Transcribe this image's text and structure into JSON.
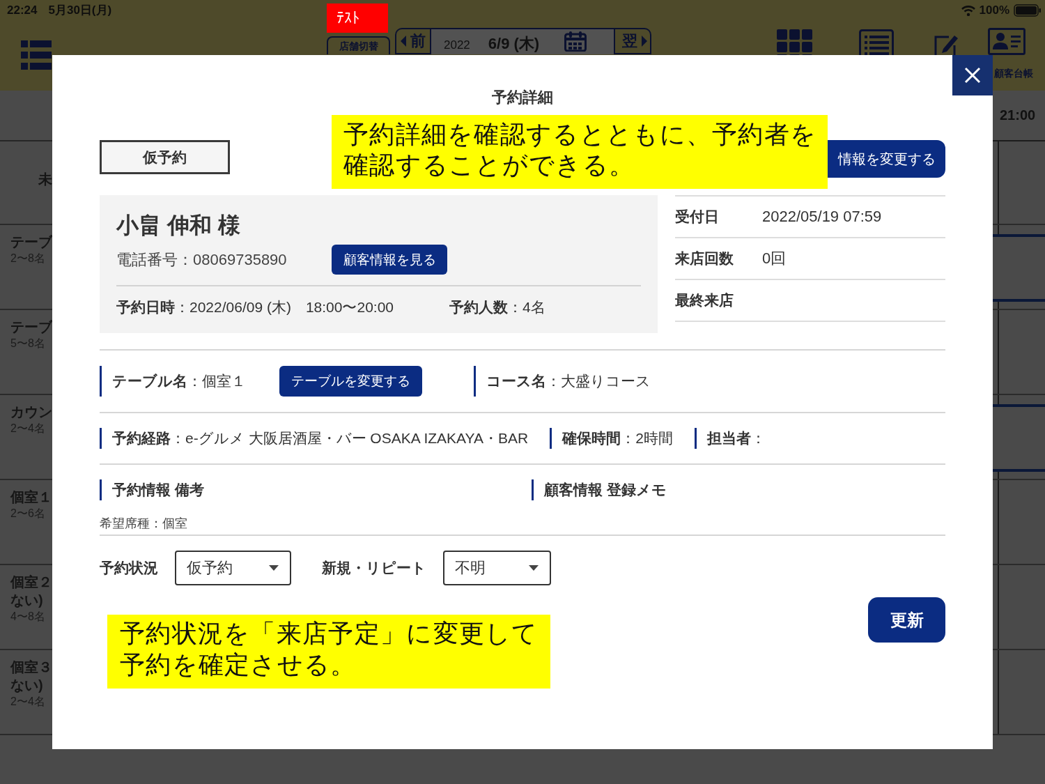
{
  "status_bar": {
    "time": "22:24",
    "date": "5月30日(月)",
    "battery": "100%"
  },
  "header": {
    "badge": "ﾃｽﾄ",
    "store_switch": "店舗切替",
    "date_nav": {
      "prev": "前",
      "year": "2022",
      "date": "6/9 (木)",
      "next": "翌"
    },
    "customer_book": "顧客台帳"
  },
  "timetable": {
    "time_label": "21:00",
    "first_row_label": "未",
    "rows": [
      {
        "name": "テーブ",
        "capacity": "2〜8名",
        "booked": true
      },
      {
        "name": "テーブ",
        "capacity": "5〜8名",
        "booked": false
      },
      {
        "name": "カウン",
        "capacity": "2〜4名",
        "booked": true
      },
      {
        "name": "個室１",
        "capacity": "2〜6名",
        "booked": false
      },
      {
        "name": "個室２",
        "note": "ない)",
        "capacity": "4〜8名",
        "booked": false
      },
      {
        "name": "個室３",
        "note": "ない)",
        "capacity": "2〜4名",
        "booked": false
      }
    ]
  },
  "modal": {
    "title": "予約詳細",
    "status_badge": "仮予約",
    "edit_customer_button": "情報を変更する",
    "customer": {
      "name": "小畠 伸和 様",
      "phone": "電話番号：08069735890",
      "view_button": "顧客情報を見る",
      "datetime": "**予約日時**：2022/06/09 (木)　18:00〜20:00",
      "party": "**予約人数**：4名"
    },
    "info": [
      {
        "label": "受付日",
        "value": "2022/05/19 07:59"
      },
      {
        "label": "来店回数",
        "value": "0回"
      },
      {
        "label": "最終来店"
      }
    ],
    "table": {
      "text": "**テーブル名**：個室１",
      "button": "テーブルを変更する"
    },
    "course": "**コース名**：大盛りコース",
    "details": [
      "**予約経路**：e-グルメ 大阪居酒屋・バー OSAKA IZAKAYA・BAR",
      "**確保時間**：2時間",
      "**担当者**："
    ],
    "notes": [
      {
        "heading": "予約情報 備考",
        "lines": [
          "希望席種：個室"
        ]
      },
      {
        "heading": "顧客情報 登録メモ"
      }
    ],
    "status_select": {
      "label": "予約状況",
      "value": "仮予約"
    },
    "repeat_select": {
      "label": "新規・リピート",
      "value": "不明"
    },
    "update_button": "更新",
    "annotations": [
      {
        "text": "予約詳細を確認するとともに、予約者を確認することができる。"
      },
      {
        "text": "予約状況を「来店予定」に変更して予約を確定させる。"
      }
    ]
  }
}
